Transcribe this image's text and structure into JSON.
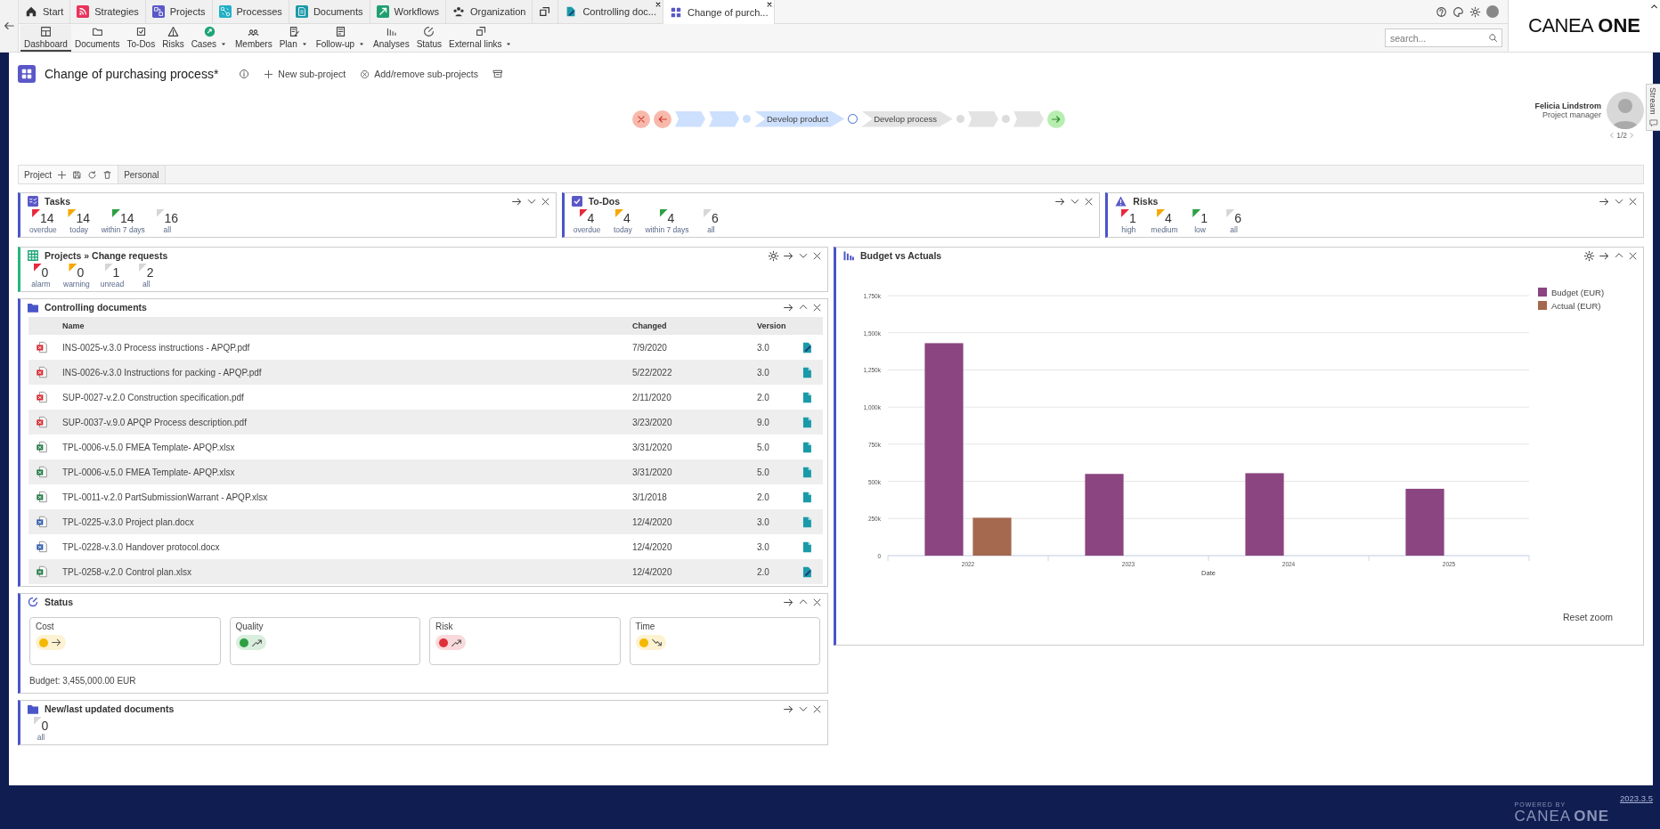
{
  "top_tabs": [
    {
      "label": "Start",
      "selected": false,
      "closable": false
    },
    {
      "label": "Strategies",
      "selected": false,
      "closable": false
    },
    {
      "label": "Projects",
      "selected": false,
      "closable": false
    },
    {
      "label": "Processes",
      "selected": false,
      "closable": false
    },
    {
      "label": "Documents",
      "selected": false,
      "closable": false
    },
    {
      "label": "Workflows",
      "selected": false,
      "closable": false
    },
    {
      "label": "Organization",
      "selected": false,
      "closable": false
    },
    {
      "selected": false,
      "closable": false
    },
    {
      "label": "Controlling doc...",
      "selected": false,
      "closable": true
    },
    {
      "label": "Change of purch...",
      "selected": true,
      "closable": true
    }
  ],
  "toolbar": [
    {
      "label": "Dashboard",
      "selected": true,
      "dropdown": false
    },
    {
      "label": "Documents",
      "selected": false,
      "dropdown": false
    },
    {
      "label": "To-Dos",
      "selected": false,
      "dropdown": false
    },
    {
      "label": "Risks",
      "selected": false,
      "dropdown": false
    },
    {
      "label": "Cases",
      "selected": false,
      "dropdown": true
    },
    {
      "label": "Members",
      "selected": false,
      "dropdown": false
    },
    {
      "label": "Plan",
      "selected": false,
      "dropdown": true
    },
    {
      "label": "Follow-up",
      "selected": false,
      "dropdown": true
    },
    {
      "label": "Analyses",
      "selected": false,
      "dropdown": false
    },
    {
      "label": "Status",
      "selected": false,
      "dropdown": false
    },
    {
      "label": "External links",
      "selected": false,
      "dropdown": true
    }
  ],
  "search": {
    "placeholder": "search..."
  },
  "logo": {
    "light": "CANEA",
    "bold": "ONE"
  },
  "project": {
    "title": "Change of purchasing process*",
    "actions": [
      "New sub-project",
      "Add/remove sub-projects"
    ]
  },
  "process": [
    {
      "kind": "cancel"
    },
    {
      "kind": "back"
    },
    {
      "kind": "chevron",
      "done": true
    },
    {
      "kind": "chevron",
      "done": true
    },
    {
      "kind": "dot",
      "done": true
    },
    {
      "kind": "chevron",
      "done": true,
      "label": "Develop product"
    },
    {
      "kind": "current"
    },
    {
      "kind": "chevron",
      "done": false,
      "label": "Develop process"
    },
    {
      "kind": "dot",
      "done": false
    },
    {
      "kind": "chevron",
      "done": false
    },
    {
      "kind": "dot",
      "done": false
    },
    {
      "kind": "chevron",
      "done": false
    },
    {
      "kind": "next"
    }
  ],
  "manager": {
    "name": "Felicia Lindstrom",
    "role": "Project manager",
    "pager": "1/2"
  },
  "dashboard_tabs": [
    {
      "label": "Project",
      "selected": true
    },
    {
      "label": "Personal",
      "selected": false
    }
  ],
  "summary_widgets": [
    {
      "title": "Tasks",
      "expanded": false,
      "counters": [
        {
          "value": "14",
          "label": "overdue",
          "color": "#e8283c"
        },
        {
          "value": "14",
          "label": "today",
          "color": "#f5a800"
        },
        {
          "value": "14",
          "label": "within 7 days",
          "color": "#2ea043"
        },
        {
          "value": "16",
          "label": "all",
          "color": "#d6d6d6"
        }
      ]
    },
    {
      "title": "To-Dos",
      "expanded": false,
      "counters": [
        {
          "value": "4",
          "label": "overdue",
          "color": "#e8283c"
        },
        {
          "value": "4",
          "label": "today",
          "color": "#f5a800"
        },
        {
          "value": "4",
          "label": "within 7 days",
          "color": "#2ea043"
        },
        {
          "value": "6",
          "label": "all",
          "color": "#d6d6d6"
        }
      ]
    },
    {
      "title": "Risks",
      "expanded": false,
      "counters": [
        {
          "value": "1",
          "label": "high",
          "color": "#e8283c"
        },
        {
          "value": "4",
          "label": "medium",
          "color": "#f5a800"
        },
        {
          "value": "1",
          "label": "low",
          "color": "#2ea043"
        },
        {
          "value": "6",
          "label": "all",
          "color": "#d6d6d6"
        }
      ]
    }
  ],
  "change_requests": {
    "title": "Projects » Change requests",
    "expanded": false,
    "counters": [
      {
        "value": "0",
        "label": "alarm",
        "color": "#e8283c"
      },
      {
        "value": "0",
        "label": "warning",
        "color": "#f5a800"
      },
      {
        "value": "1",
        "label": "unread",
        "color": "#d6d6d6"
      },
      {
        "value": "2",
        "label": "all",
        "color": "#d6d6d6"
      }
    ]
  },
  "controlling_documents": {
    "title": "Controlling documents",
    "expanded": true,
    "columns": [
      "Name",
      "Changed",
      "Version"
    ],
    "rows": [
      {
        "kind": "pdf",
        "name": "INS-0025-v.3.0 Process instructions - APQP.pdf",
        "changed": "7/9/2020",
        "version": "3.0",
        "checked_out": true
      },
      {
        "kind": "pdf",
        "name": "INS-0026-v.3.0 Instructions for packing - APQP.pdf",
        "changed": "5/22/2022",
        "version": "3.0",
        "checked_out": false
      },
      {
        "kind": "pdf",
        "name": "SUP-0027-v.2.0 Construction specification.pdf",
        "changed": "2/11/2020",
        "version": "2.0",
        "checked_out": false
      },
      {
        "kind": "pdf",
        "name": "SUP-0037-v.9.0 APQP Process description.pdf",
        "changed": "3/23/2020",
        "version": "9.0",
        "checked_out": false
      },
      {
        "kind": "xlsx",
        "name": "TPL-0006-v.5.0 FMEA Template- APQP.xlsx",
        "changed": "3/31/2020",
        "version": "5.0",
        "checked_out": false
      },
      {
        "kind": "xlsx",
        "name": "TPL-0006-v.5.0 FMEA Template- APQP.xlsx",
        "changed": "3/31/2020",
        "version": "5.0",
        "checked_out": false
      },
      {
        "kind": "xlsx",
        "name": "TPL-0011-v.2.0 PartSubmissionWarrant - APQP.xlsx",
        "changed": "3/1/2018",
        "version": "2.0",
        "checked_out": false
      },
      {
        "kind": "docx",
        "name": "TPL-0225-v.3.0 Project plan.docx",
        "changed": "12/4/2020",
        "version": "3.0",
        "checked_out": false
      },
      {
        "kind": "docx",
        "name": "TPL-0228-v.3.0 Handover protocol.docx",
        "changed": "12/4/2020",
        "version": "3.0",
        "checked_out": false
      },
      {
        "kind": "xlsx",
        "name": "TPL-0258-v.2.0 Control plan.xlsx",
        "changed": "12/4/2020",
        "version": "2.0",
        "checked_out": true
      }
    ]
  },
  "status": {
    "title": "Status",
    "expanded": true,
    "cards": [
      {
        "label": "Cost",
        "color": "#f5b800",
        "kind": "flat"
      },
      {
        "label": "Quality",
        "color": "#2ea043",
        "kind": "up"
      },
      {
        "label": "Risk",
        "color": "#e02f3a",
        "kind": "up"
      },
      {
        "label": "Time",
        "color": "#f5b800",
        "kind": "down"
      }
    ],
    "budget": "Budget: 3,455,000.00 EUR"
  },
  "new_documents": {
    "title": "New/last updated documents",
    "expanded": false,
    "counters": [
      {
        "value": "0",
        "label": "all",
        "color": "#d6d6d6"
      }
    ]
  },
  "budget_chart": {
    "title": "Budget vs Actuals",
    "expanded": true,
    "reset": "Reset zoom",
    "chart_data": {
      "type": "bar",
      "xlabel": "Date",
      "categories": [
        "2022",
        "2023",
        "2024",
        "2025"
      ],
      "series": [
        {
          "name": "Budget (EUR)",
          "color": "#8b4580",
          "values": [
            1430000,
            550000,
            555000,
            450000
          ]
        },
        {
          "name": "Actual (EUR)",
          "color": "#a4694e",
          "values": [
            255000,
            null,
            null,
            null
          ]
        }
      ],
      "ylim": [
        0,
        1750000
      ],
      "grid": true,
      "legend": true,
      "yticks": [
        {
          "value": 0,
          "label": "0"
        },
        {
          "value": 250000,
          "label": "250k"
        },
        {
          "value": 500000,
          "label": "500k"
        },
        {
          "value": 750000,
          "label": "750k"
        },
        {
          "value": 1000000,
          "label": "1,000k"
        },
        {
          "value": 1250000,
          "label": "1,250k"
        },
        {
          "value": 1500000,
          "label": "1,500k"
        },
        {
          "value": 1750000,
          "label": "1,750k"
        }
      ]
    }
  },
  "stream_tab": "Stream",
  "footer": {
    "powered": "POWERED BY",
    "brand_light": "CANEA",
    "brand_bold": "ONE",
    "version": "2023.3.5"
  }
}
